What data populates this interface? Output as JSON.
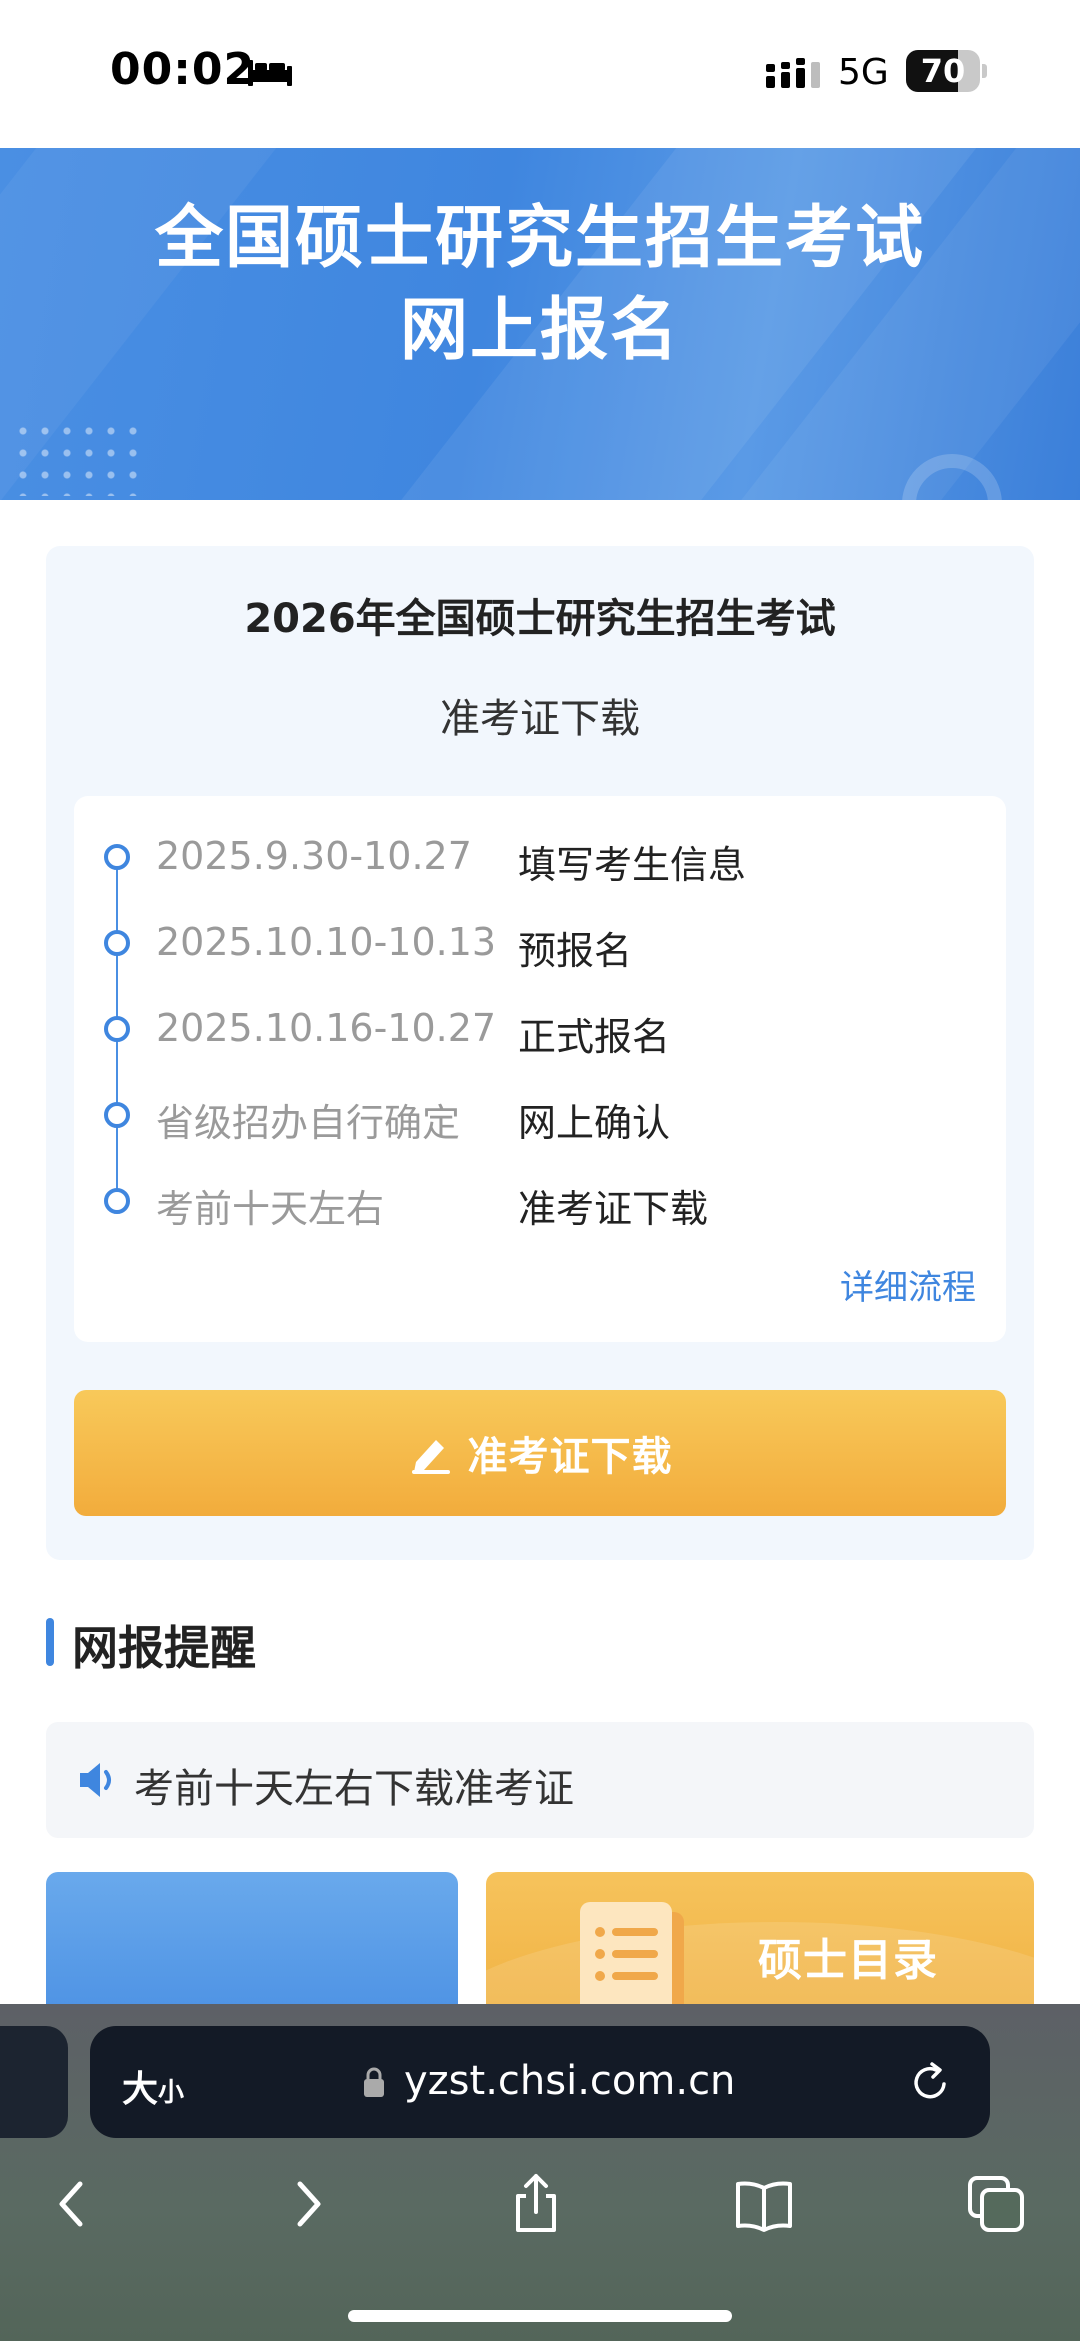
{
  "status_bar": {
    "time": "00:02",
    "network": "5G",
    "battery_text": "70",
    "battery_level": 0.7,
    "icons": [
      "sleep-icon",
      "signal-icon"
    ]
  },
  "banner": {
    "title_line1": "全国硕士研究生招生考试",
    "title_line2": "网上报名"
  },
  "card": {
    "title": "2026年全国硕士研究生招生考试",
    "subtitle": "准考证下载",
    "timeline": [
      {
        "date": "2025.9.30-10.27",
        "step": "填写考生信息"
      },
      {
        "date": "2025.10.10-10.13",
        "step": "预报名"
      },
      {
        "date": "2025.10.16-10.27",
        "step": "正式报名"
      },
      {
        "date": "省级招办自行确定",
        "step": "网上确认"
      },
      {
        "date": "考前十天左右",
        "step": "准考证下载"
      }
    ],
    "detail_link": "详细流程",
    "download_button": "准考证下载"
  },
  "reminder": {
    "section_title": "网报提醒",
    "notice": "考前十天左右下载准考证"
  },
  "tiles": {
    "right_label": "硕士目录"
  },
  "browser": {
    "text_size_big": "大",
    "text_size_small": "小",
    "url": "yzst.chsi.com.cn",
    "nav_icons": [
      "back-icon",
      "forward-icon",
      "share-icon",
      "bookmarks-icon",
      "tabs-icon"
    ]
  },
  "colors": {
    "primary_blue": "#3f86df",
    "button_orange": "#f2ac3c",
    "card_bg": "#f2f7fd"
  }
}
